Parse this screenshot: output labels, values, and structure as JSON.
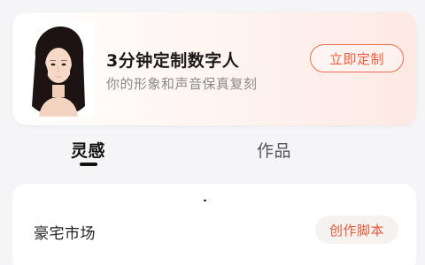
{
  "banner": {
    "title": "3分钟定制数字人",
    "subtitle": "你的形象和声音保真复刻",
    "button_label": "立即定制",
    "accent_color": "#e85d3c"
  },
  "tabs": [
    {
      "label": "灵感",
      "active": true
    },
    {
      "label": "作品",
      "active": false
    }
  ],
  "content": {
    "items": [
      {
        "title": "豪宅市场",
        "action_label": "创作脚本"
      }
    ]
  }
}
